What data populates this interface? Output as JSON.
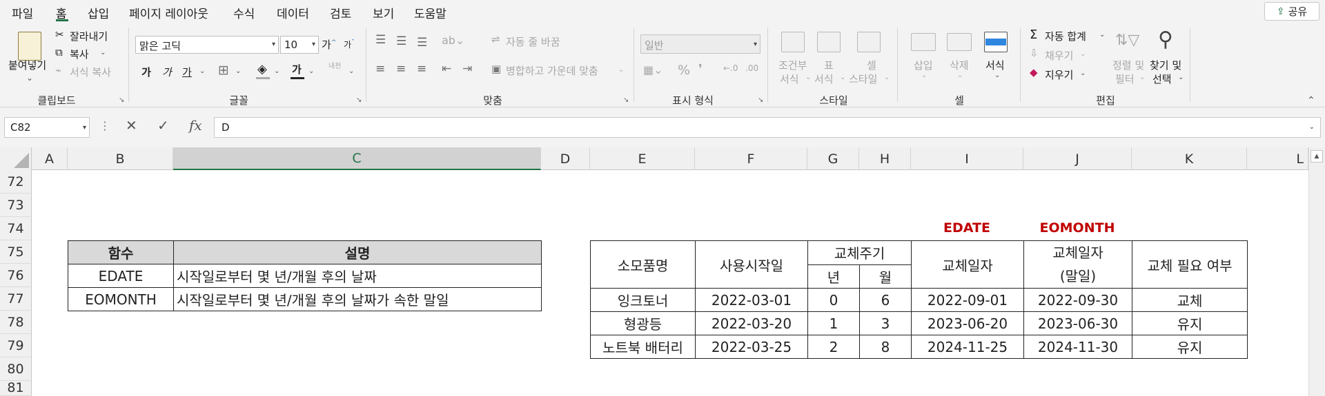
{
  "menu": {
    "items": [
      "파일",
      "홈",
      "삽입",
      "페이지 레이아웃",
      "수식",
      "데이터",
      "검토",
      "보기",
      "도움말"
    ],
    "share": "공유"
  },
  "ribbon": {
    "clipboard": {
      "paste": "붙여넣기",
      "cut": "잘라내기",
      "copy": "복사",
      "format_painter": "서식 복사",
      "label": "클립보드"
    },
    "font": {
      "name": "맑은 고딕",
      "size": "10",
      "grow": "가",
      "shrink": "가",
      "bold": "가",
      "italic": "가",
      "underline": "가",
      "font_color": "가",
      "phonetic": "내천",
      "label": "글꼴"
    },
    "alignment": {
      "wrap": "자동 줄 바꿈",
      "merge": "병합하고 가운데 맞춤",
      "label": "맞춤"
    },
    "number": {
      "format": "일반",
      "percent": "%",
      "label": "표시 형식"
    },
    "styles": {
      "conditional": [
        "조건부",
        "서식"
      ],
      "table": [
        "표",
        "서식"
      ],
      "cell": [
        "셀",
        "스타일"
      ],
      "label": "스타일"
    },
    "cells": {
      "insert": "삽입",
      "delete": "삭제",
      "format": "서식",
      "label": "셀"
    },
    "editing": {
      "autosum": "자동 합계",
      "fill": "채우기",
      "clear": "지우기",
      "sort": [
        "정렬 및",
        "필터"
      ],
      "find": [
        "찾기 및",
        "선택"
      ],
      "label": "편집"
    }
  },
  "formula_bar": {
    "name_box": "C82",
    "formula": "D"
  },
  "columns": [
    "A",
    "B",
    "C",
    "D",
    "E",
    "F",
    "G",
    "H",
    "I",
    "J",
    "K",
    "L"
  ],
  "rows": [
    "72",
    "73",
    "74",
    "75",
    "76",
    "77",
    "78",
    "79",
    "80",
    "81"
  ],
  "func_table": {
    "headers": [
      "함수",
      "설명"
    ],
    "rows": [
      [
        "EDATE",
        "시작일로부터 몇 년/개월 후의 날짜"
      ],
      [
        "EOMONTH",
        "시작일로부터 몇 년/개월 후의 날짜가 속한 말일"
      ]
    ]
  },
  "labels": {
    "edate": "EDATE",
    "eomonth": "EOMONTH"
  },
  "supply_table": {
    "headers": {
      "item": "소모품명",
      "start": "사용시작일",
      "cycle": "교체주기",
      "year": "년",
      "month": "월",
      "replace": "교체일자",
      "replace_eom": [
        "교체일자",
        "(말일)"
      ],
      "need": "교체 필요 여부"
    },
    "rows": [
      [
        "잉크토너",
        "2022-03-01",
        "0",
        "6",
        "2022-09-01",
        "2022-09-30",
        "교체"
      ],
      [
        "형광등",
        "2022-03-20",
        "1",
        "3",
        "2023-06-20",
        "2023-06-30",
        "유지"
      ],
      [
        "노트북 배터리",
        "2022-03-25",
        "2",
        "8",
        "2024-11-25",
        "2024-11-30",
        "유지"
      ]
    ]
  }
}
